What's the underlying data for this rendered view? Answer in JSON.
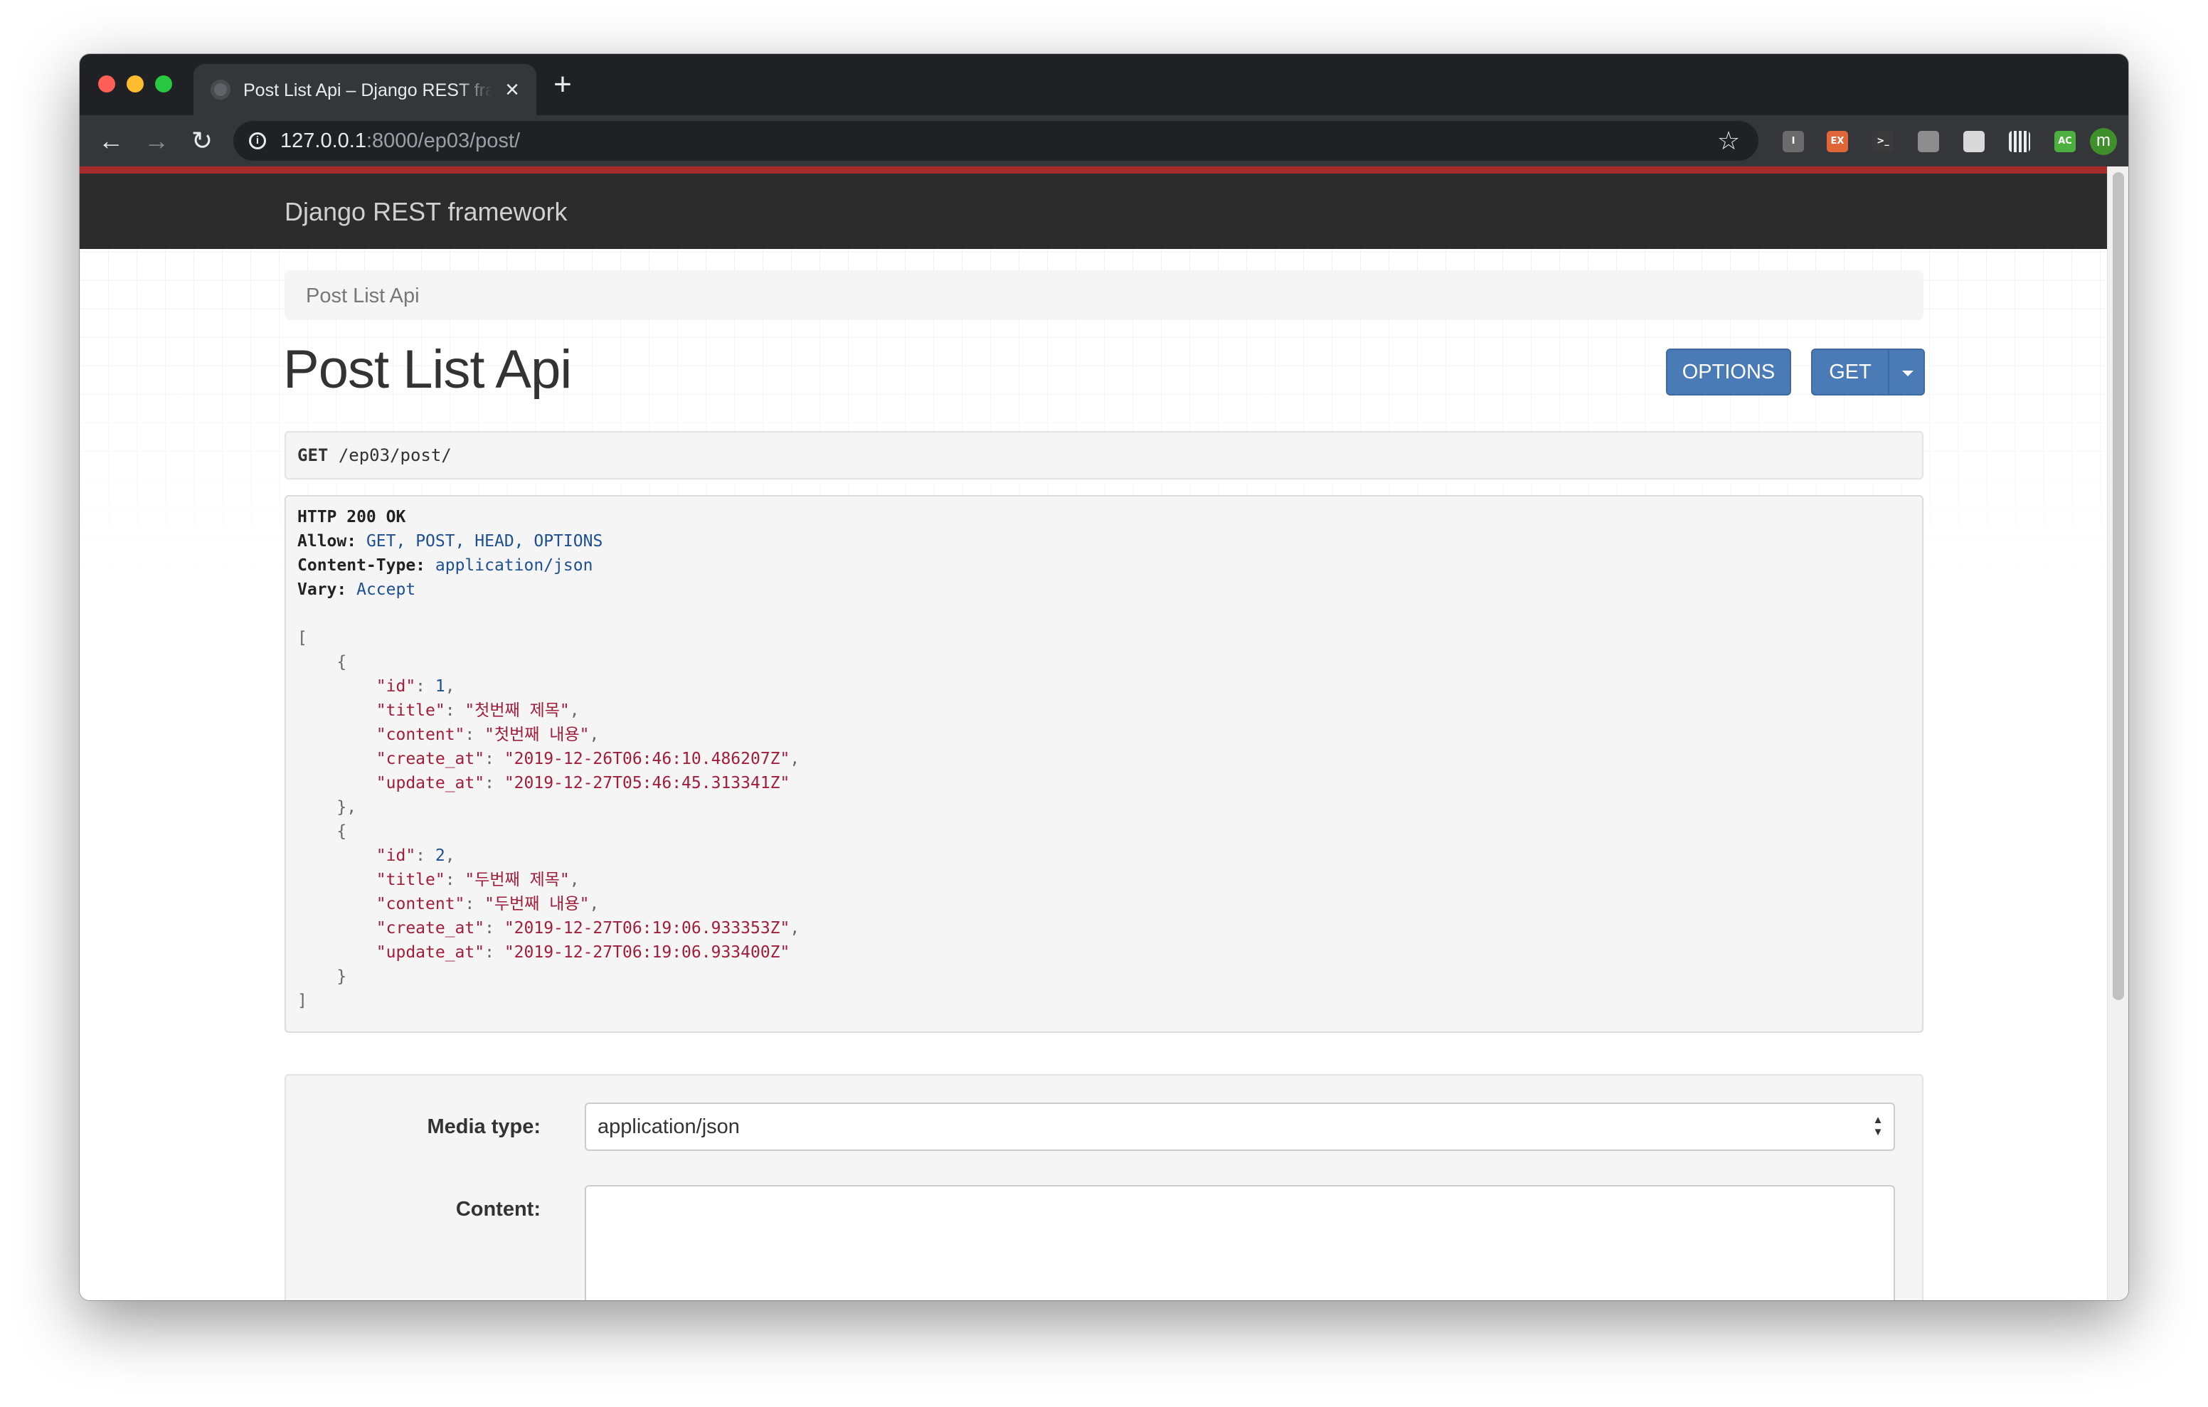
{
  "browser": {
    "tab_title": "Post List Api – Django REST framework",
    "new_tab_icon": "plus-icon",
    "url_host": "127.0.0.1",
    "url_rest": ":8000/ep03/post/",
    "extensions": [
      {
        "label": "I",
        "color": "#6b6b6b"
      },
      {
        "label": "EX",
        "color": "#e0663a"
      },
      {
        "label": ">_",
        "color": "#3a3a3a"
      },
      {
        "label": "",
        "color": "#8d8d8d"
      },
      {
        "label": "",
        "color": "#d9d9d9"
      },
      {
        "label": "",
        "color": "#b0b0b0"
      },
      {
        "label": "AC",
        "color": "#4caf3f"
      }
    ],
    "avatar_letter": "m"
  },
  "drf": {
    "brand": "Django REST framework",
    "breadcrumb": "Post List Api",
    "page_title": "Post List Api",
    "buttons": {
      "options": "OPTIONS",
      "get": "GET"
    }
  },
  "request": {
    "method": "GET",
    "path": "/ep03/post/"
  },
  "response": {
    "status": "HTTP 200 OK",
    "headers": [
      {
        "key": "Allow:",
        "value": "GET, POST, HEAD, OPTIONS"
      },
      {
        "key": "Content-Type:",
        "value": "application/json"
      },
      {
        "key": "Vary:",
        "value": "Accept"
      }
    ],
    "posts": [
      {
        "id": "1",
        "title": "\"첫번째 제목\"",
        "content": "\"첫번째 내용\"",
        "create_at": "\"2019-12-26T06:46:10.486207Z\"",
        "update_at": "\"2019-12-27T05:46:45.313341Z\""
      },
      {
        "id": "2",
        "title": "\"두번째 제목\"",
        "content": "\"두번째 내용\"",
        "create_at": "\"2019-12-27T06:19:06.933353Z\"",
        "update_at": "\"2019-12-27T06:19:06.933400Z\""
      }
    ]
  },
  "form": {
    "media_type_label": "Media type:",
    "media_type_value": "application/json",
    "content_label": "Content:"
  },
  "colors": {
    "topbar_accent": "#a52a2a",
    "navbar": "#2c2c2c",
    "button_primary": "#4a7bb7"
  }
}
